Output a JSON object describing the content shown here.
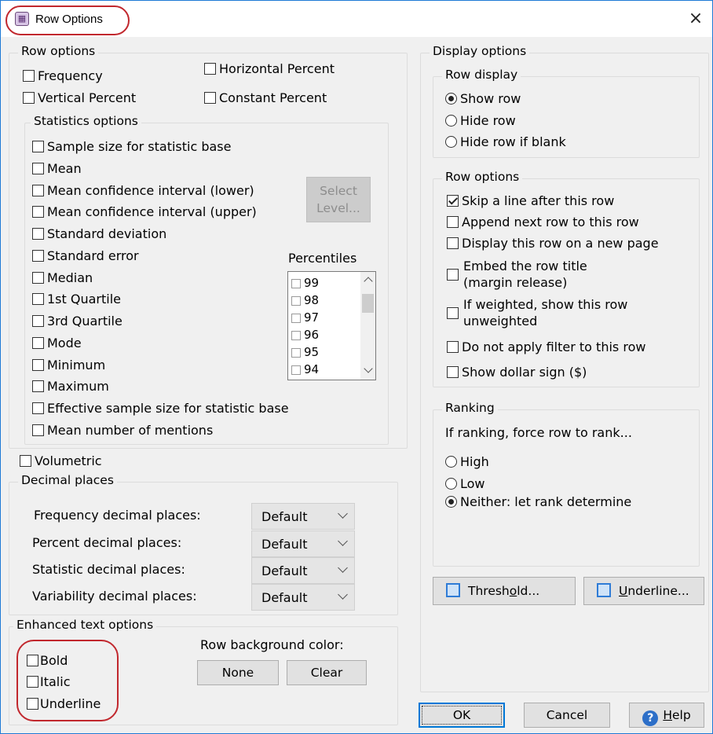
{
  "window": {
    "title": "Row Options",
    "close_glyph": "×",
    "app_icon": "app-icon"
  },
  "row_options": {
    "legend": "Row options",
    "frequency": "Frequency",
    "horizontal_percent": "Horizontal Percent",
    "vertical_percent": "Vertical Percent",
    "constant_percent": "Constant Percent"
  },
  "statistics_options": {
    "legend": "Statistics options",
    "items": [
      "Sample size for statistic base",
      "Mean",
      "Mean confidence interval (lower)",
      "Mean confidence interval (upper)",
      "Standard deviation",
      "Standard error",
      "Median",
      "1st Quartile",
      "3rd Quartile",
      "Mode",
      "Minimum",
      "Maximum",
      "Effective sample size for statistic base",
      "Mean number of mentions"
    ],
    "select_level_line1": "Select",
    "select_level_line2": "Level...",
    "percentiles_label": "Percentiles",
    "percentiles": [
      "99",
      "98",
      "97",
      "96",
      "95",
      "94"
    ]
  },
  "volumetric": "Volumetric",
  "decimal_places": {
    "legend": "Decimal places",
    "rows": [
      {
        "label": "Frequency decimal places:",
        "value": "Default"
      },
      {
        "label": "Percent decimal places:",
        "value": "Default"
      },
      {
        "label": "Statistic decimal places:",
        "value": "Default"
      },
      {
        "label": "Variability decimal places:",
        "value": "Default"
      }
    ]
  },
  "enhanced_text": {
    "legend": "Enhanced text options",
    "bold": "Bold",
    "italic": "Italic",
    "underline": "Underline",
    "bg_color_label": "Row background color:",
    "none_button": "None",
    "clear_button": "Clear"
  },
  "display_options": {
    "legend": "Display options",
    "row_display": {
      "legend": "Row display",
      "options": [
        "Show row",
        "Hide row",
        "Hide row if blank"
      ],
      "selected": "Show row"
    },
    "row_options": {
      "legend": "Row options",
      "skip_line": "Skip a line after this row",
      "append_next": "Append next row to this row",
      "new_page": "Display this row on a new page",
      "embed_title_1": "Embed the row title",
      "embed_title_2": "(margin release)",
      "weighted_1": "If weighted, show this row",
      "weighted_2": "unweighted",
      "no_filter": "Do not apply filter to this row",
      "dollar_sign": "Show dollar sign ($)"
    },
    "ranking": {
      "legend": "Ranking",
      "prompt": "If ranking, force row to rank...",
      "options": [
        "High",
        "Low",
        "Neither: let rank determine"
      ],
      "selected": "Neither: let rank determine"
    },
    "threshold_pre": "Thresh",
    "threshold_acc": "o",
    "threshold_post": "ld...",
    "underline_acc": "U",
    "underline_post": "nderline..."
  },
  "footer": {
    "ok": "OK",
    "cancel": "Cancel",
    "help_acc": "H",
    "help_post": "elp"
  },
  "colors": {
    "highlight": "#c1272d",
    "window_border": "#1e7ad6",
    "accent_icon": "#2f7cd6"
  }
}
